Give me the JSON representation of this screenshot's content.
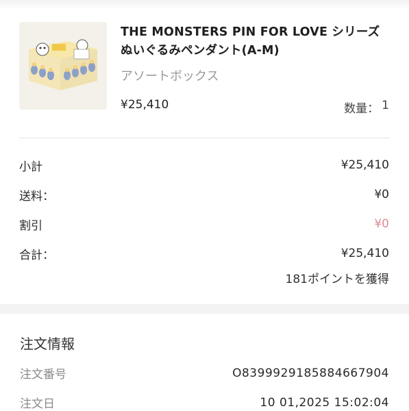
{
  "product": {
    "title": "THE MONSTERS PIN FOR LOVE シリーズ ぬいぐるみペンダント(A-M)",
    "variant": "アソートボックス",
    "price": "¥25,410",
    "qty_label": "数量：",
    "qty_value": "1"
  },
  "summary": {
    "subtotal_label": "小計",
    "subtotal_value": "¥25,410",
    "shipping_label": "送料：",
    "shipping_value": "¥0",
    "discount_label": "割引",
    "discount_value": "¥0",
    "total_label": "合計：",
    "total_value": "¥25,410",
    "points": "181ポイントを獲得"
  },
  "order_info": {
    "title": "注文情報",
    "number_label": "注文番号",
    "number_value": "O839992918588466790‌4",
    "date_label": "注文日",
    "date_value": "10 01,2025 15:02:04"
  },
  "colors": {
    "discount": "#e08a96",
    "muted": "#8a8a8a",
    "divider": "#e4e4e4"
  }
}
